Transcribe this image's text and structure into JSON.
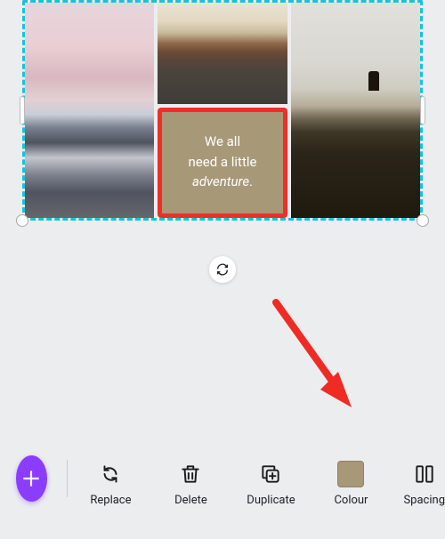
{
  "card": {
    "line1": "We all",
    "line2": "need a little",
    "line3_em": "adventure",
    "trailing": "."
  },
  "colour_swatch_hex": "#a79878",
  "toolbar": {
    "replace": "Replace",
    "delete": "Delete",
    "duplicate": "Duplicate",
    "colour": "Colour",
    "spacing": "Spacing"
  },
  "icons": {
    "fab": "plus-icon",
    "replace": "replace-arrows-icon",
    "delete": "trash-icon",
    "duplicate": "duplicate-icon",
    "cycle": "cycle-icon",
    "spacing": "spacing-icon"
  }
}
